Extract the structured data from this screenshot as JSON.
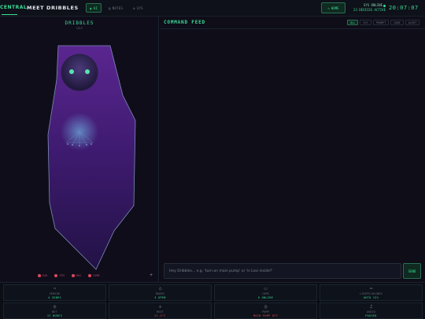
{
  "topbar": {
    "brand": "CENTRAL",
    "title": "MEET DRIBBLES",
    "tabs": [
      {
        "icon": "◉",
        "label": "AI"
      },
      {
        "icon": "▤",
        "label": "NOTES"
      },
      {
        "icon": "⚙",
        "label": "SYS"
      }
    ],
    "home_label": "HOME",
    "sys_online": "SYS ONLINE",
    "devices_active": "23 DEVICES ACTIVE",
    "clock": "20:07:07"
  },
  "bot": {
    "name": "DRIBBLES",
    "state": "IDLE",
    "status_leds": [
      {
        "label": "EAR"
      },
      {
        "label": "STM"
      },
      {
        "label": "MAG"
      },
      {
        "label": "COMM"
      }
    ],
    "plus_label": "+"
  },
  "feed": {
    "title": "COMMAND FEED",
    "filters": [
      "ALL",
      "SYS",
      "PROMPT",
      "CODE",
      "ALERT"
    ],
    "input_placeholder": "Hey Dribbles... e.g. 'turn on main pump' or 'is Lexi inside?'",
    "send_label": "SEND"
  },
  "tiles": [
    {
      "icon": "♒",
      "label": "SENSOR",
      "value": "4 ZONES",
      "warn": false
    },
    {
      "icon": "⌂",
      "label": "DOORS",
      "value": "3 OPEN",
      "warn": false
    },
    {
      "icon": "▭",
      "label": "CAMS",
      "value": "6 ONLINE",
      "warn": false
    },
    {
      "icon": "⌓",
      "label": "LIGHTS/BLINDS",
      "value": "AUTO 12%",
      "warn": false
    },
    {
      "icon": "◎",
      "label": "NET",
      "value": "12 NODES",
      "warn": false
    },
    {
      "icon": "✢",
      "label": "HEAT",
      "value": "21.4°C",
      "warn": true
    },
    {
      "icon": "◷",
      "label": "PUMP",
      "value": "MAIN PUMP OFF",
      "warn": true
    },
    {
      "icon": "♫",
      "label": "AUDIO",
      "value": "PAUSED",
      "warn": false
    }
  ],
  "colors": {
    "accent": "#3ddc97",
    "alert": "#e0485b",
    "robot_body": "#4a1f7a",
    "eye": "#58e2b0"
  }
}
